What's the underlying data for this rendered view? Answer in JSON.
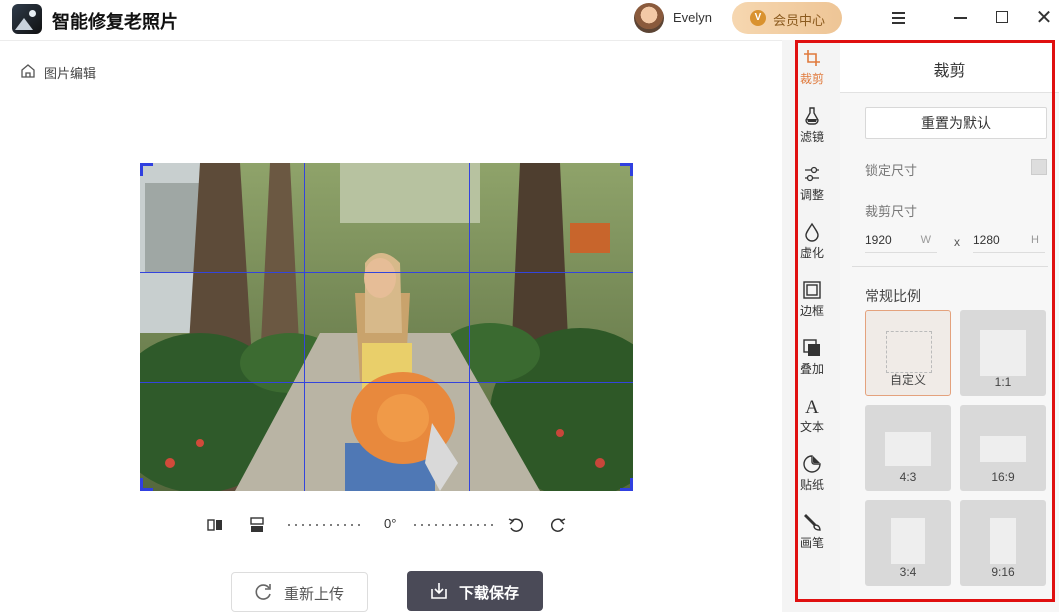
{
  "app": {
    "title": "智能修复老照片"
  },
  "user": {
    "name": "Evelyn"
  },
  "vip": {
    "badge": "V",
    "label": "会员中心"
  },
  "window": {
    "close_glyph": "✕"
  },
  "breadcrumb": {
    "label": "图片编辑"
  },
  "editor": {
    "rotation": "0°",
    "reupload_label": "重新上传",
    "download_label": "下载保存"
  },
  "tools": [
    {
      "label": "裁剪",
      "icon": "crop-icon",
      "active": true
    },
    {
      "label": "滤镜",
      "icon": "filter-icon"
    },
    {
      "label": "调整",
      "icon": "adjust-icon"
    },
    {
      "label": "虚化",
      "icon": "blur-icon"
    },
    {
      "label": "边框",
      "icon": "frame-icon"
    },
    {
      "label": "叠加",
      "icon": "overlay-icon"
    },
    {
      "label": "文本",
      "icon": "text-icon"
    },
    {
      "label": "贴纸",
      "icon": "sticker-icon"
    },
    {
      "label": "画笔",
      "icon": "brush-icon"
    }
  ],
  "panel": {
    "title": "裁剪",
    "reset_label": "重置为默认",
    "lock_label": "锁定尺寸",
    "crop_size_label": "裁剪尺寸",
    "width": {
      "value": "1920",
      "unit": "W"
    },
    "x_sep": "x",
    "height": {
      "value": "1280",
      "unit": "H"
    },
    "ratio_label": "常规比例",
    "ratios": [
      {
        "label": "自定义",
        "selected": true
      },
      {
        "label": "1:1"
      },
      {
        "label": "4:3"
      },
      {
        "label": "16:9"
      },
      {
        "label": "3:4"
      },
      {
        "label": "9:16"
      }
    ]
  },
  "colors": {
    "accent": "#e4a27d",
    "highlight": "#e01010",
    "grid": "#3344dd",
    "primary_button": "#4a4a57"
  }
}
